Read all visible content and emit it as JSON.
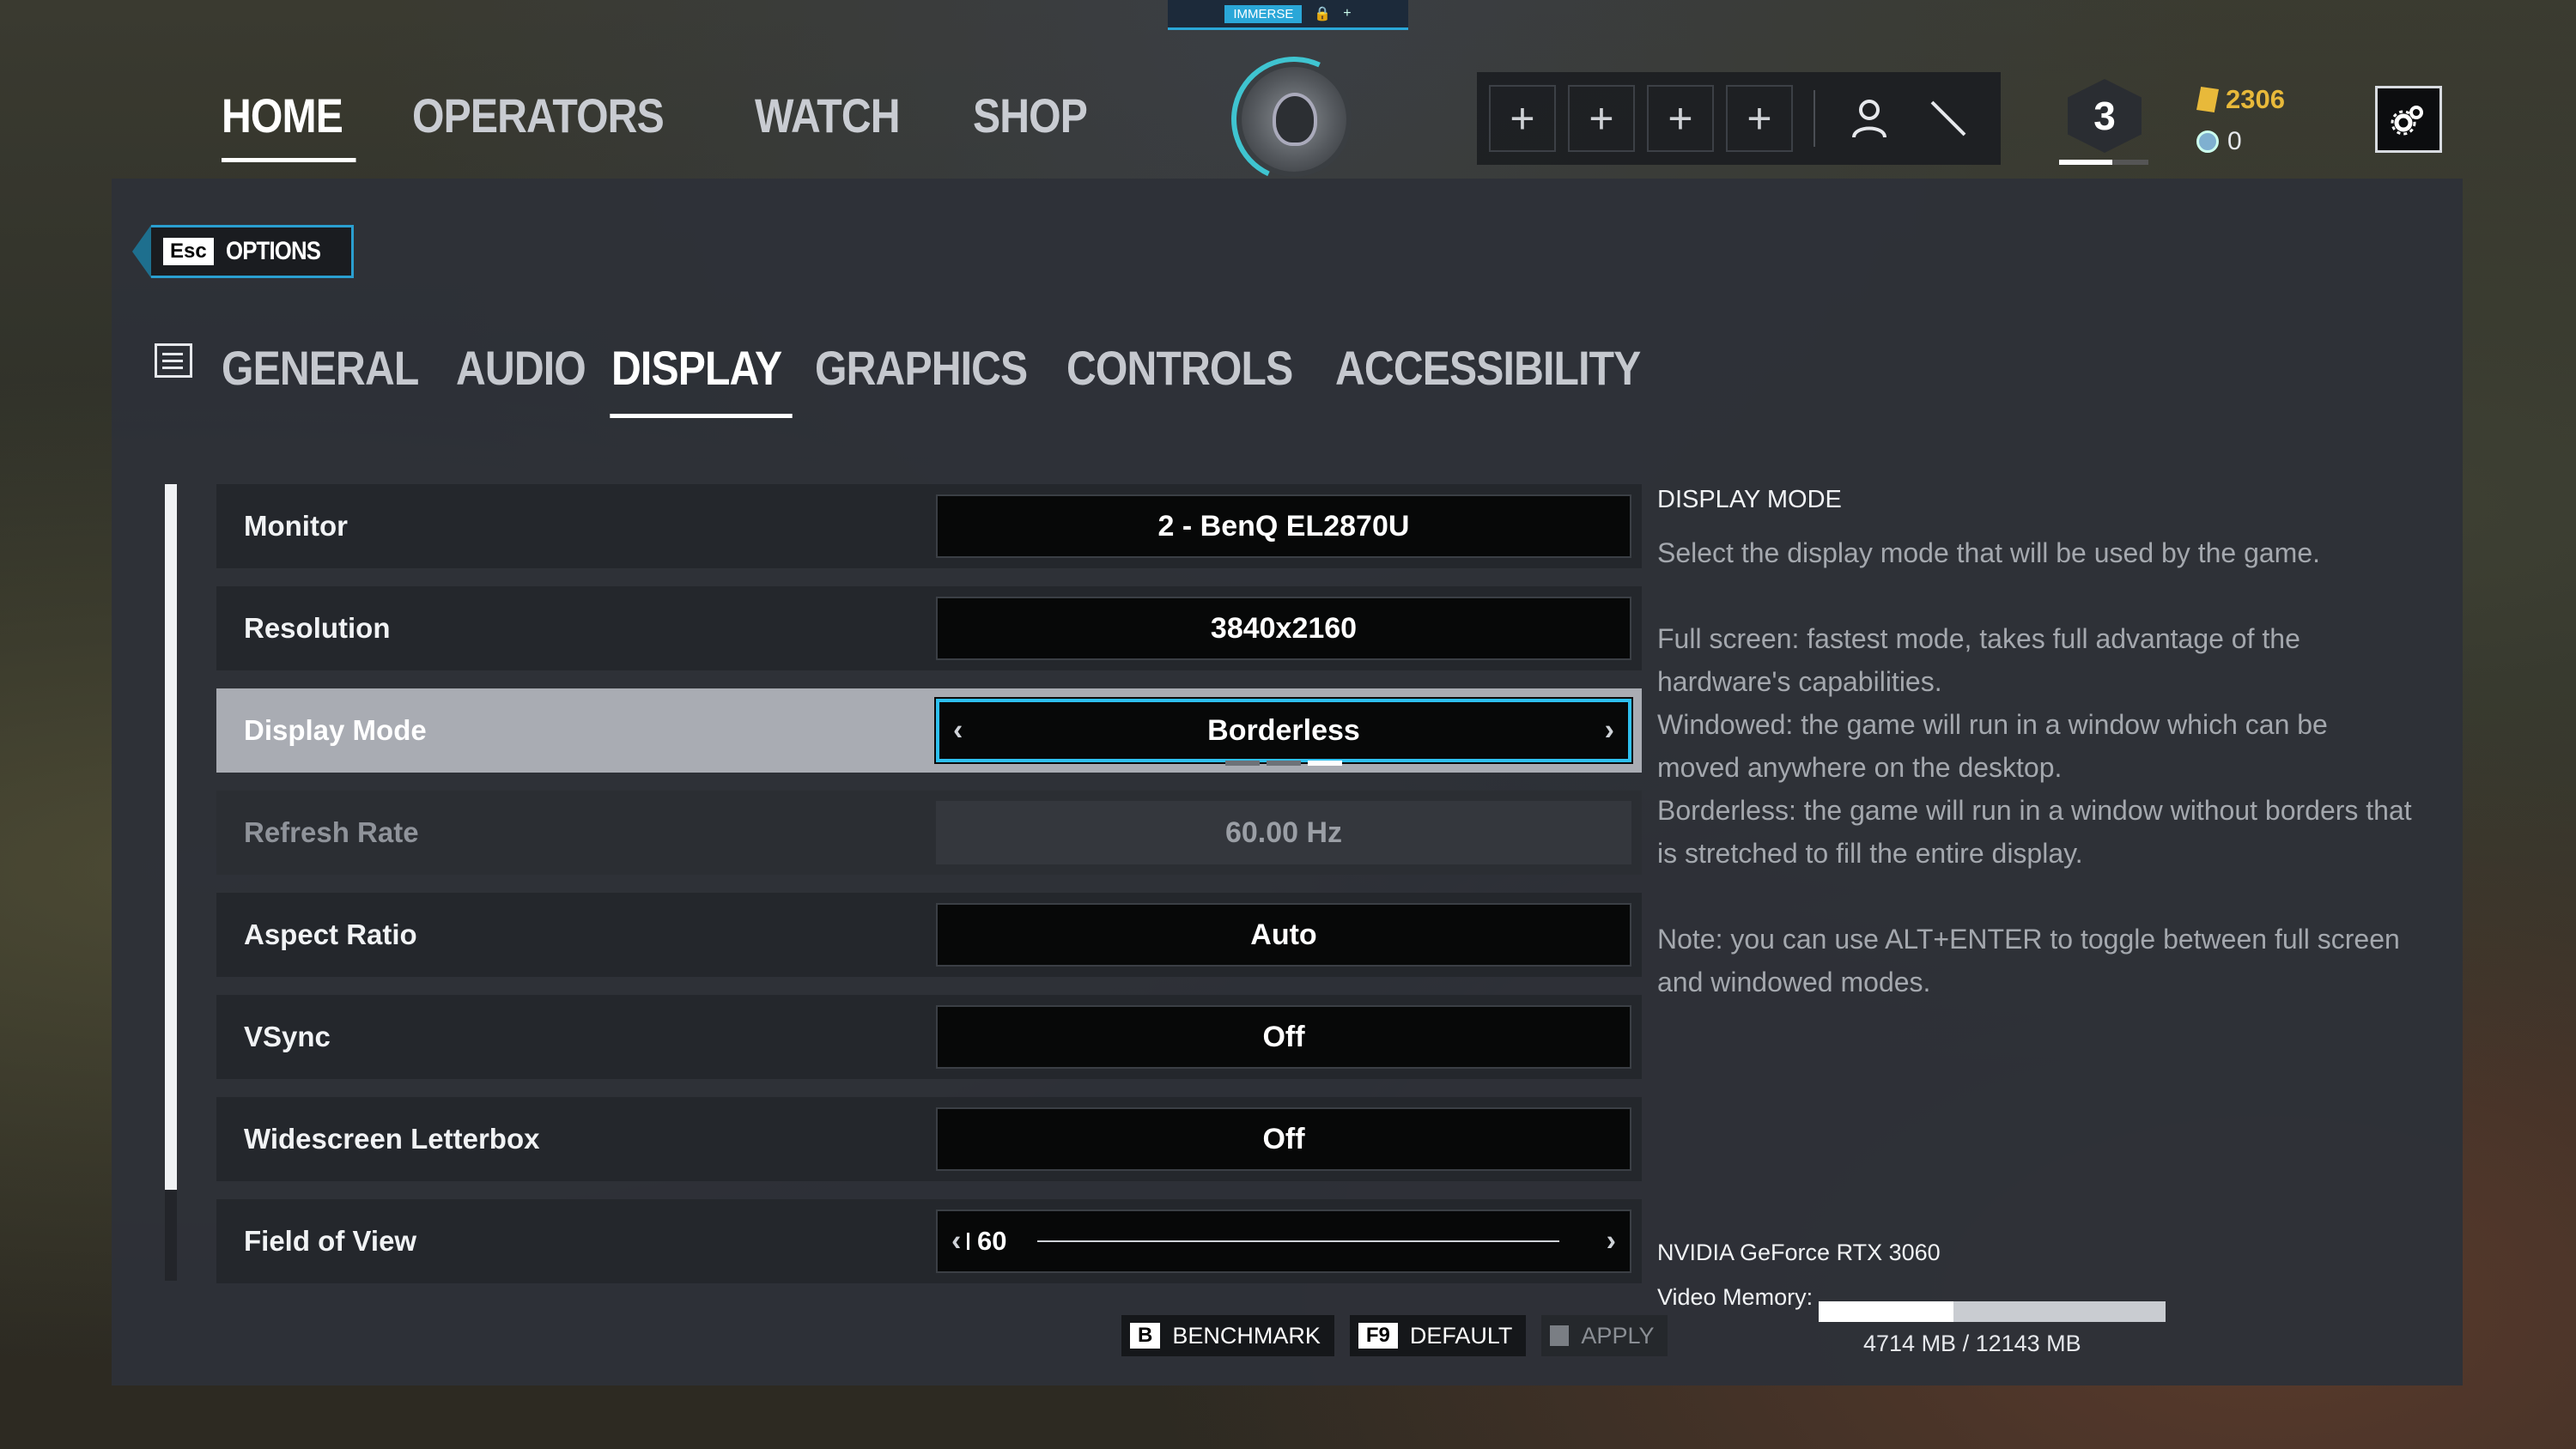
{
  "brand": {
    "label": "IMMERSE",
    "plus": "+"
  },
  "nav": [
    {
      "label": "HOME",
      "active": true
    },
    {
      "label": "OPERATORS"
    },
    {
      "label": "WATCH"
    },
    {
      "label": "SHOP"
    }
  ],
  "squad": {
    "slots": [
      "+",
      "+",
      "+",
      "+"
    ],
    "icons": [
      "person-icon",
      "slash-icon"
    ]
  },
  "rank": {
    "level": "3",
    "progress": 0.6
  },
  "currency": {
    "renown": "2306",
    "credits": "0"
  },
  "options": {
    "esc_key": "Esc",
    "label": "OPTIONS"
  },
  "tabs": [
    {
      "label": "GENERAL"
    },
    {
      "label": "AUDIO"
    },
    {
      "label": "DISPLAY",
      "active": true
    },
    {
      "label": "GRAPHICS"
    },
    {
      "label": "CONTROLS"
    },
    {
      "label": "ACCESSIBILITY"
    }
  ],
  "settings": [
    {
      "label": "Monitor",
      "value": "2 - BenQ EL2870U"
    },
    {
      "label": "Resolution",
      "value": "3840x2160"
    },
    {
      "label": "Display Mode",
      "value": "Borderless",
      "selected": true,
      "option_index": 2,
      "option_count": 3
    },
    {
      "label": "Refresh Rate",
      "value": "60.00 Hz",
      "disabled": true
    },
    {
      "label": "Aspect Ratio",
      "value": "Auto"
    },
    {
      "label": "VSync",
      "value": "Off"
    },
    {
      "label": "Widescreen Letterbox",
      "value": "Off"
    },
    {
      "label": "Field of View",
      "value": "60",
      "slider": true
    }
  ],
  "actions": [
    {
      "key": "B",
      "label": "BENCHMARK"
    },
    {
      "key": "F9",
      "label": "DEFAULT"
    },
    {
      "key": "",
      "label": "APPLY",
      "disabled": true
    }
  ],
  "help": {
    "title": "DISPLAY MODE",
    "intro": "Select the display mode that will be used by the game.",
    "full": "Full screen: fastest mode, takes full advantage of the hardware's capabilities.",
    "windowed": "Windowed: the game will run in a window which can be moved anywhere on the desktop.",
    "borderless": "Borderless: the game will run in a window without borders that is stretched to fill the entire display.",
    "note": "Note: you can use ALT+ENTER to toggle between full screen and windowed modes."
  },
  "gpu": {
    "name": "NVIDIA GeForce RTX 3060",
    "vram_label": "Video Memory:",
    "vram_text": "4714 MB / 12143 MB",
    "vram_used_fraction": 0.388
  },
  "colors": {
    "accent": "#2ec0f0",
    "currency": "#e8b93a"
  }
}
